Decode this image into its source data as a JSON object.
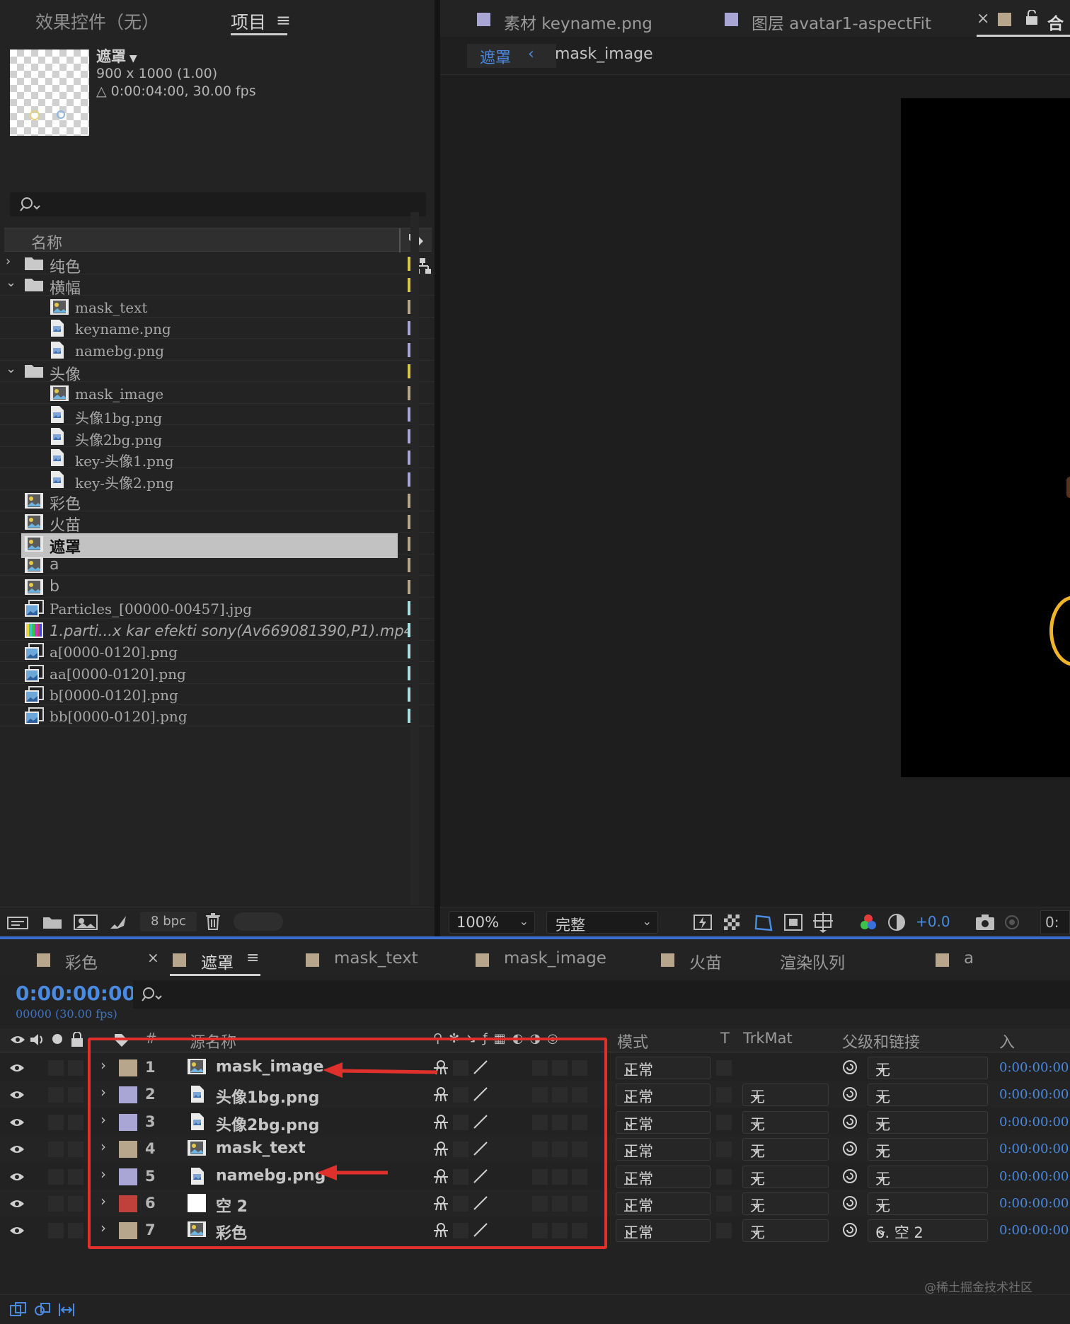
{
  "project_panel": {
    "tab_effect_controls": "效果控件（无）",
    "tab_project": "项目",
    "comp_name": "遮罩",
    "comp_dims": "900 x 1000 (1.00)",
    "comp_duration": "△ 0:00:04:00, 30.00 fps",
    "col_name": "名称",
    "items": [
      {
        "label": "纯色",
        "kind": "folder",
        "expanded": false,
        "indent": 0,
        "tag": "#d8c84a"
      },
      {
        "label": "横幅",
        "kind": "folder",
        "expanded": true,
        "indent": 0,
        "tag": "#d8c84a"
      },
      {
        "label": "mask_text",
        "kind": "comp",
        "indent": 1,
        "tag": "#b8a68c"
      },
      {
        "label": "keyname.png",
        "kind": "file",
        "indent": 1,
        "tag": "#a9a6d6"
      },
      {
        "label": "namebg.png",
        "kind": "file",
        "indent": 1,
        "tag": "#a9a6d6"
      },
      {
        "label": "头像",
        "kind": "folder",
        "expanded": true,
        "indent": 0,
        "tag": "#d8c84a"
      },
      {
        "label": "mask_image",
        "kind": "comp",
        "indent": 1,
        "tag": "#b8a68c"
      },
      {
        "label": "头像1bg.png",
        "kind": "file",
        "indent": 1,
        "tag": "#a9a6d6"
      },
      {
        "label": "头像2bg.png",
        "kind": "file",
        "indent": 1,
        "tag": "#a9a6d6"
      },
      {
        "label": "key-头像1.png",
        "kind": "file",
        "indent": 1,
        "tag": "#a9a6d6"
      },
      {
        "label": "key-头像2.png",
        "kind": "file",
        "indent": 1,
        "tag": "#a9a6d6"
      },
      {
        "label": "彩色",
        "kind": "comp",
        "indent": 0,
        "tag": "#b8a68c"
      },
      {
        "label": "火苗",
        "kind": "comp",
        "indent": 0,
        "tag": "#b8a68c"
      },
      {
        "label": "遮罩",
        "kind": "comp",
        "indent": 0,
        "tag": "#b8a68c",
        "selected": true
      },
      {
        "label": "a",
        "kind": "comp",
        "indent": 0,
        "tag": "#b8a68c"
      },
      {
        "label": "b",
        "kind": "comp",
        "indent": 0,
        "tag": "#b8a68c"
      },
      {
        "label": "Particles_[00000-00457].jpg",
        "kind": "seq",
        "indent": 0,
        "tag": "#a8e0e0"
      },
      {
        "label": "1.parti...x kar efekti sony(Av669081390,P1).mp4",
        "kind": "video",
        "indent": 0,
        "tag": "#a8e0e0",
        "italic": true
      },
      {
        "label": "a[0000-0120].png",
        "kind": "seq",
        "indent": 0,
        "tag": "#a8e0e0"
      },
      {
        "label": "aa[0000-0120].png",
        "kind": "seq",
        "indent": 0,
        "tag": "#a8e0e0"
      },
      {
        "label": "b[0000-0120].png",
        "kind": "seq",
        "indent": 0,
        "tag": "#a8e0e0"
      },
      {
        "label": "bb[0000-0120].png",
        "kind": "seq",
        "indent": 0,
        "tag": "#a8e0e0"
      }
    ],
    "bpc": "8 bpc"
  },
  "viewer": {
    "tabs": [
      {
        "label": "素材 keyname.png",
        "swatch": "#a9a6d6"
      },
      {
        "label": "图层 avatar1-aspectFit",
        "swatch": "#a9a6d6"
      }
    ],
    "comp_tab_label": "合",
    "breadcrumb_active": "遮罩",
    "breadcrumb_child": "mask_image",
    "zoom": "100%",
    "quality": "完整",
    "exposure": "+0.0",
    "timecode_cut": "0:"
  },
  "timeline": {
    "tabs": [
      {
        "label": "彩色",
        "swatch": "#b8a68c"
      },
      {
        "label": "遮罩",
        "swatch": "#b8a68c",
        "active": true
      },
      {
        "label": "mask_text",
        "swatch": "#b8a68c"
      },
      {
        "label": "mask_image",
        "swatch": "#b8a68c"
      },
      {
        "label": "火苗",
        "swatch": "#b8a68c"
      },
      {
        "label": "渲染队列",
        "swatch": ""
      },
      {
        "label": "a",
        "swatch": "#b8a68c"
      }
    ],
    "timecode": "0:00:00:00",
    "frame_info": "00000 (30.00 fps)",
    "headers": {
      "num": "#",
      "source": "源名称",
      "mode": "模式",
      "t": "T",
      "trkmat": "TrkMat",
      "parent": "父级和链接",
      "in": "入"
    },
    "layers": [
      {
        "num": "1",
        "name": "mask_image",
        "kind": "comp",
        "label": "#b8a68c",
        "mode": "正常",
        "trkmat": "",
        "parent": "无",
        "in": "0:00:00:00",
        "arrow": true
      },
      {
        "num": "2",
        "name": "头像1bg.png",
        "kind": "file",
        "label": "#a9a6d6",
        "mode": "正常",
        "trkmat": "无",
        "parent": "无",
        "in": "0:00:00:00"
      },
      {
        "num": "3",
        "name": "头像2bg.png",
        "kind": "file",
        "label": "#a9a6d6",
        "mode": "正常",
        "trkmat": "无",
        "parent": "无",
        "in": "0:00:00:00"
      },
      {
        "num": "4",
        "name": "mask_text",
        "kind": "comp",
        "label": "#b8a68c",
        "mode": "正常",
        "trkmat": "无",
        "parent": "无",
        "in": "0:00:00:00",
        "arrow": true
      },
      {
        "num": "5",
        "name": "namebg.png",
        "kind": "file",
        "label": "#a9a6d6",
        "mode": "正常",
        "trkmat": "无",
        "parent": "无",
        "in": "0:00:00:00"
      },
      {
        "num": "6",
        "name": "空 2",
        "kind": "null",
        "label": "#c0403b",
        "mode": "正常",
        "trkmat": "无",
        "parent": "无",
        "in": "0:00:00:00"
      },
      {
        "num": "7",
        "name": "彩色",
        "kind": "comp",
        "label": "#b8a68c",
        "mode": "正常",
        "trkmat": "无",
        "parent": "6. 空 2",
        "in": "0:00:00:00"
      }
    ],
    "watermark": "@稀土掘金技术社区"
  },
  "colors": {
    "accent_blue": "#4a8ae0",
    "highlight_red": "#e0302b"
  }
}
